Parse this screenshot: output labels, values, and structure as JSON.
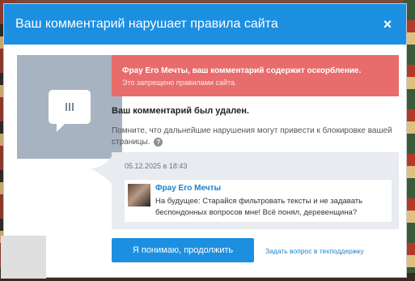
{
  "modal": {
    "title": "Ваш комментарий нарушает правила сайта",
    "close_label": "×"
  },
  "alert": {
    "title": "Фрау Его Мечты, ваш комментарий содержит оскорбление.",
    "subtitle": "Это запрещено правилами сайта."
  },
  "status": {
    "deleted_title": "Ваш комментарий был удален.",
    "warning": "Помните, что дальнейшие нарушения могут привести к блокировке вашей страницы.",
    "help_label": "?"
  },
  "comment": {
    "date": "05.12.2025 в 18:43",
    "author": "Фрау Его Мечты",
    "text": "На будущее: Старайся фильтровать тексты и не задавать беспондонных вопросов мне! Всё понял, деревенщина?"
  },
  "actions": {
    "primary_label": "Я понимаю, продолжить",
    "support_link": "Задать вопрос в техподдержку"
  },
  "colors": {
    "header": "#1d8fe1",
    "alert": "#e86c6c",
    "comment_bg": "#e8ebef",
    "link": "#1d7fc7"
  }
}
